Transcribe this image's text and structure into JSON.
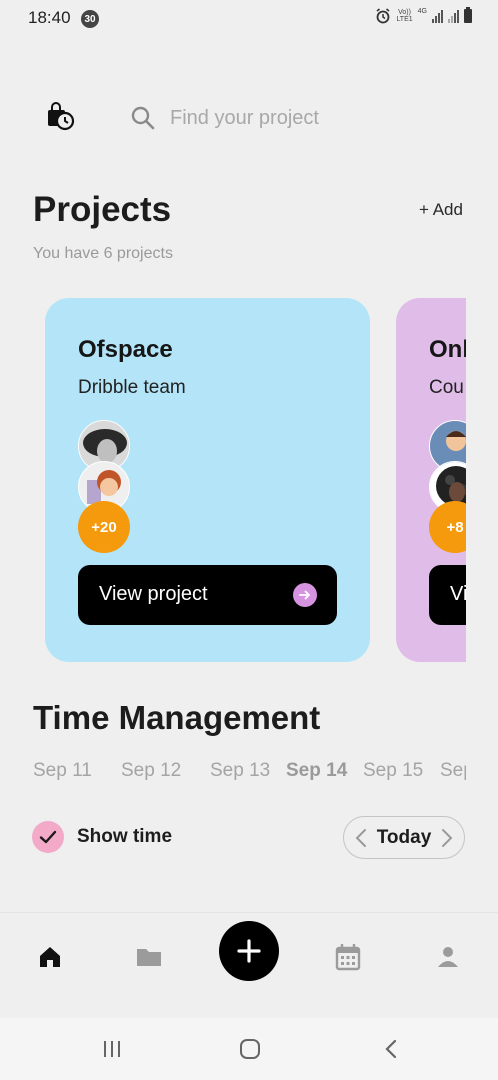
{
  "status_bar": {
    "time": "18:40",
    "notification_count": "30",
    "volte": "Vo))",
    "lte": "LTE1",
    "network": "4G",
    "icons": [
      "alarm-icon",
      "signal-icon",
      "signal-icon",
      "battery-icon"
    ]
  },
  "search": {
    "placeholder": "Find your project",
    "icon": "search-icon",
    "left_icon": "clock-bag-icon"
  },
  "projects": {
    "title": "Projects",
    "add_label": "+ Add",
    "subtitle": "You have 6 projects",
    "cards": [
      {
        "title": "Ofspace",
        "subtitle": "Dribble team",
        "member_count": "+20",
        "button_label": "View project",
        "color": "#b3e4f8"
      },
      {
        "title": "Onl",
        "subtitle": "Cou",
        "member_count": "+8",
        "button_label": "Vi",
        "color": "#dfbde8"
      }
    ]
  },
  "time_management": {
    "title": "Time Management",
    "dates": [
      "Sep 11",
      "Sep 12",
      "Sep 13",
      "Sep 14",
      "Sep 15",
      "Sep"
    ],
    "active_date": "Sep 14",
    "show_time_label": "Show time",
    "today_label": "Today"
  },
  "bottom_nav": {
    "items": [
      "home-icon",
      "folder-icon",
      "add-icon",
      "calendar-icon",
      "profile-icon"
    ],
    "active": "home-icon"
  },
  "colors": {
    "background": "#efefef",
    "card_blue": "#b3e4f8",
    "card_purple": "#dfbde8",
    "accent_orange": "#f59a0c",
    "accent_pink": "#f3a9c8",
    "arrow_purple": "#d693e0"
  }
}
